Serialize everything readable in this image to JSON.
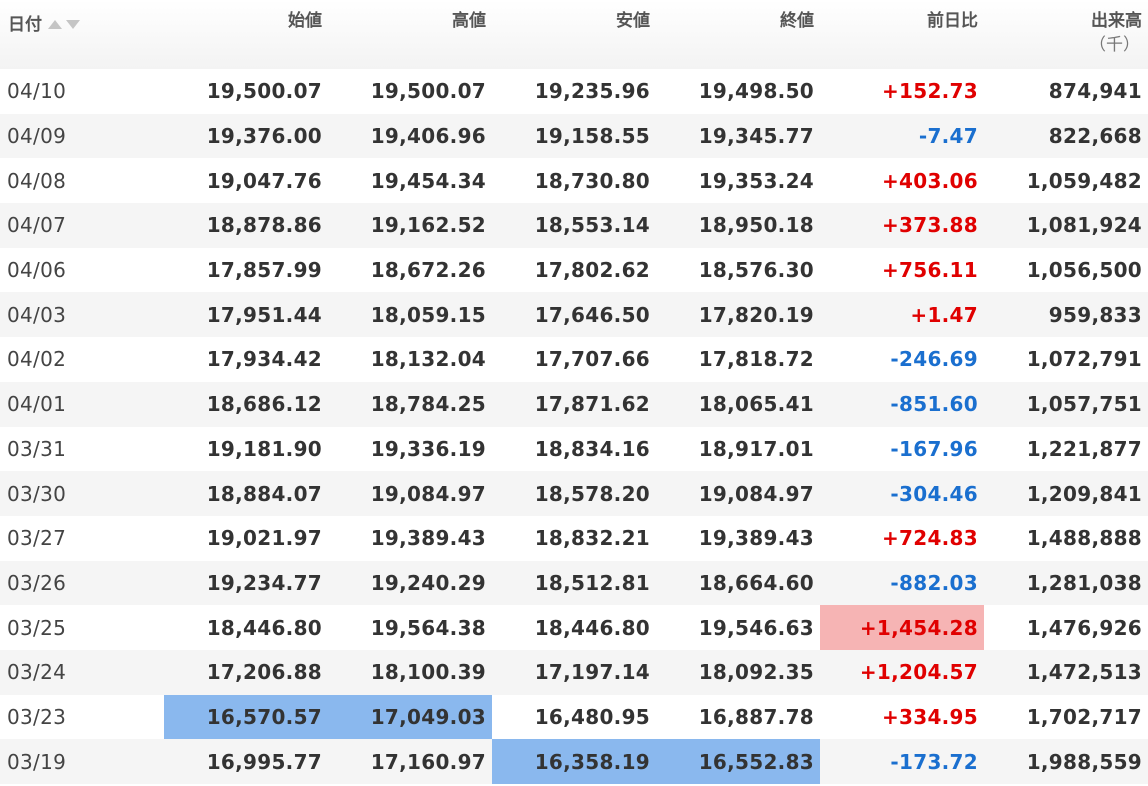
{
  "table": {
    "headers": {
      "date": "日付",
      "open": "始値",
      "high": "高値",
      "low": "安値",
      "close": "終値",
      "change": "前日比",
      "volume": "出来高",
      "volume_unit": "（千）"
    },
    "sort_icons": [
      "sort-ascending-icon",
      "sort-descending-icon"
    ],
    "colors": {
      "positive": "#e00000",
      "negative": "#1a6fcf",
      "highlight_blue": "#8ab8ee",
      "highlight_red": "#f6b4b4"
    },
    "rows": [
      {
        "date": "04/10",
        "open": "19,500.07",
        "high": "19,500.07",
        "low": "19,235.96",
        "close": "19,498.50",
        "change": "+152.73",
        "volume": "874,941"
      },
      {
        "date": "04/09",
        "open": "19,376.00",
        "high": "19,406.96",
        "low": "19,158.55",
        "close": "19,345.77",
        "change": "-7.47",
        "volume": "822,668"
      },
      {
        "date": "04/08",
        "open": "19,047.76",
        "high": "19,454.34",
        "low": "18,730.80",
        "close": "19,353.24",
        "change": "+403.06",
        "volume": "1,059,482"
      },
      {
        "date": "04/07",
        "open": "18,878.86",
        "high": "19,162.52",
        "low": "18,553.14",
        "close": "18,950.18",
        "change": "+373.88",
        "volume": "1,081,924"
      },
      {
        "date": "04/06",
        "open": "17,857.99",
        "high": "18,672.26",
        "low": "17,802.62",
        "close": "18,576.30",
        "change": "+756.11",
        "volume": "1,056,500"
      },
      {
        "date": "04/03",
        "open": "17,951.44",
        "high": "18,059.15",
        "low": "17,646.50",
        "close": "17,820.19",
        "change": "+1.47",
        "volume": "959,833"
      },
      {
        "date": "04/02",
        "open": "17,934.42",
        "high": "18,132.04",
        "low": "17,707.66",
        "close": "17,818.72",
        "change": "-246.69",
        "volume": "1,072,791"
      },
      {
        "date": "04/01",
        "open": "18,686.12",
        "high": "18,784.25",
        "low": "17,871.62",
        "close": "18,065.41",
        "change": "-851.60",
        "volume": "1,057,751"
      },
      {
        "date": "03/31",
        "open": "19,181.90",
        "high": "19,336.19",
        "low": "18,834.16",
        "close": "18,917.01",
        "change": "-167.96",
        "volume": "1,221,877"
      },
      {
        "date": "03/30",
        "open": "18,884.07",
        "high": "19,084.97",
        "low": "18,578.20",
        "close": "19,084.97",
        "change": "-304.46",
        "volume": "1,209,841"
      },
      {
        "date": "03/27",
        "open": "19,021.97",
        "high": "19,389.43",
        "low": "18,832.21",
        "close": "19,389.43",
        "change": "+724.83",
        "volume": "1,488,888"
      },
      {
        "date": "03/26",
        "open": "19,234.77",
        "high": "19,240.29",
        "low": "18,512.81",
        "close": "18,664.60",
        "change": "-882.03",
        "volume": "1,281,038"
      },
      {
        "date": "03/25",
        "open": "18,446.80",
        "high": "19,564.38",
        "low": "18,446.80",
        "close": "19,546.63",
        "change": "+1,454.28",
        "volume": "1,476,926"
      },
      {
        "date": "03/24",
        "open": "17,206.88",
        "high": "18,100.39",
        "low": "17,197.14",
        "close": "18,092.35",
        "change": "+1,204.57",
        "volume": "1,472,513"
      },
      {
        "date": "03/23",
        "open": "16,570.57",
        "high": "17,049.03",
        "low": "16,480.95",
        "close": "16,887.78",
        "change": "+334.95",
        "volume": "1,702,717"
      },
      {
        "date": "03/19",
        "open": "16,995.77",
        "high": "17,160.97",
        "low": "16,358.19",
        "close": "16,552.83",
        "change": "-173.72",
        "volume": "1,988,559"
      }
    ]
  }
}
